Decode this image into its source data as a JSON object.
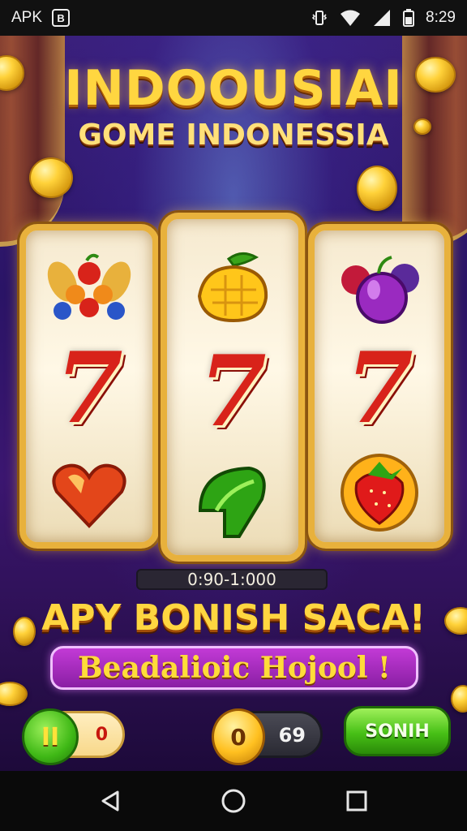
{
  "status_bar": {
    "carrier": "APK",
    "app_badge": "B",
    "time": "8:29"
  },
  "game": {
    "title": "INDOOUSIAI",
    "subtitle": "GOME INDONESSIA",
    "reels": [
      [
        "mixed-fruit-cluster",
        "seven",
        "heart-gem"
      ],
      [
        "mango",
        "seven",
        "green-leaf"
      ],
      [
        "plum-and-berries",
        "seven",
        "strawberry"
      ]
    ],
    "seven_symbol": "7",
    "bet_range": "0:90-1:000",
    "bonus_headline": "APY BONISH SACA!",
    "promo_banner": "Beadalioic Hojool !"
  },
  "controls": {
    "pause_icon": "II",
    "pause_value": "0",
    "coin_icon": "0",
    "coin_value": "69",
    "spin_label": "SONIH"
  },
  "colors": {
    "gold": "#ffd640",
    "reel_frame": "#e8b13c",
    "seven_red": "#d8231a",
    "promo_purple": "#a02cbc",
    "spin_green": "#47c016"
  }
}
